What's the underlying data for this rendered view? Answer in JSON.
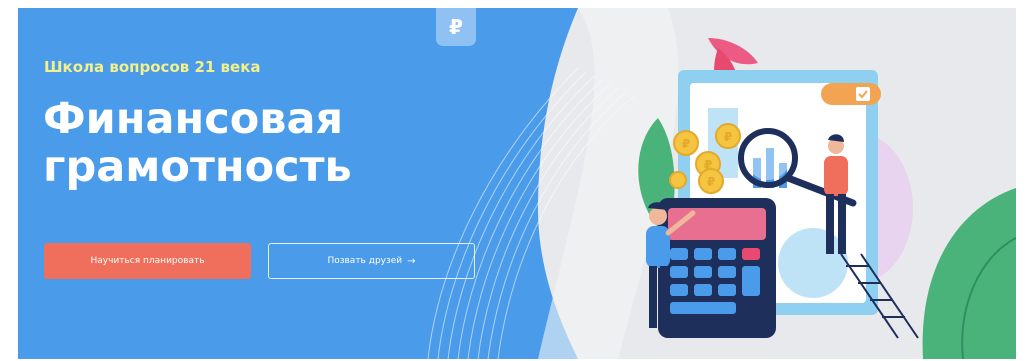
{
  "banner": {
    "subtitle": "Школа вопросов 21 века",
    "title_line1": "Финансовая",
    "title_line2": "грамотность",
    "primary_button": "Научиться планировать",
    "secondary_button": "Позвать друзей",
    "secondary_arrow": "→",
    "badge_symbol": "₽",
    "coin_symbol": "₽"
  },
  "colors": {
    "blue": "#4a9bea",
    "coral": "#ef6f5c",
    "yellow_text": "#f4f08a",
    "grey_bg": "#e8e9ec"
  },
  "icons": [
    "ruble-badge-icon",
    "arrow-right-icon",
    "check-icon",
    "magnifier-icon",
    "calculator-icon",
    "coin-icon",
    "leaf-icon"
  ]
}
